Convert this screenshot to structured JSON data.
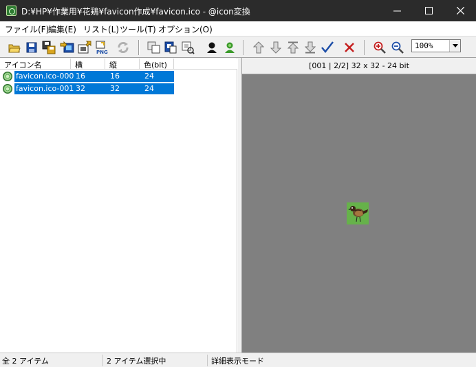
{
  "window": {
    "title": "D:¥HP¥作業用¥花鶏¥favicon作成¥favicon.ico - @icon変換",
    "controls": [
      "minimize",
      "maximize",
      "close"
    ]
  },
  "menu": [
    {
      "label": "ファイル(F)"
    },
    {
      "label": "編集(E)"
    },
    {
      "label": "リスト(L)"
    },
    {
      "label": "ツール(T)"
    },
    {
      "label": "オプション(O)"
    }
  ],
  "toolbar": {
    "buttons": [
      {
        "icon": "open-folder-icon"
      },
      {
        "icon": "save-icon"
      },
      {
        "icon": "save-all-icon"
      },
      {
        "icon": "export-icon"
      },
      {
        "icon": "import-icon"
      },
      {
        "icon": "png-icon",
        "text": "PNG"
      },
      {
        "icon": "convert-icon"
      },
      {
        "icon": "copy-icon"
      },
      {
        "icon": "paste-icon"
      },
      {
        "icon": "duplicate-icon"
      },
      {
        "icon": "person-black-icon"
      },
      {
        "icon": "person-green-icon"
      },
      {
        "icon": "move-up-icon"
      },
      {
        "icon": "move-down-icon"
      },
      {
        "icon": "move-top-icon"
      },
      {
        "icon": "move-bottom-icon"
      },
      {
        "icon": "check-icon"
      },
      {
        "icon": "delete-icon"
      },
      {
        "icon": "zoom-in-icon"
      },
      {
        "icon": "zoom-out-icon"
      }
    ],
    "zoom_value": "100%"
  },
  "list": {
    "columns": [
      "アイコン名",
      "横",
      "縦",
      "色(bit)"
    ],
    "rows": [
      {
        "name": "favicon.ico-000",
        "width": "16",
        "height": "16",
        "bits": "24",
        "selected": true
      },
      {
        "name": "favicon.ico-001",
        "width": "32",
        "height": "32",
        "bits": "24",
        "selected": true
      }
    ]
  },
  "preview": {
    "info": "[001 | 2/2] 32 x 32 - 24 bit",
    "background_color": "#808080"
  },
  "status": {
    "total": "全 2 アイテム",
    "selected": "2 アイテム選択中",
    "mode": "詳細表示モード"
  },
  "colors": {
    "titlebar": "#2b2b2b",
    "selection": "#0078d7",
    "thumb_bg": "#66b24a"
  }
}
